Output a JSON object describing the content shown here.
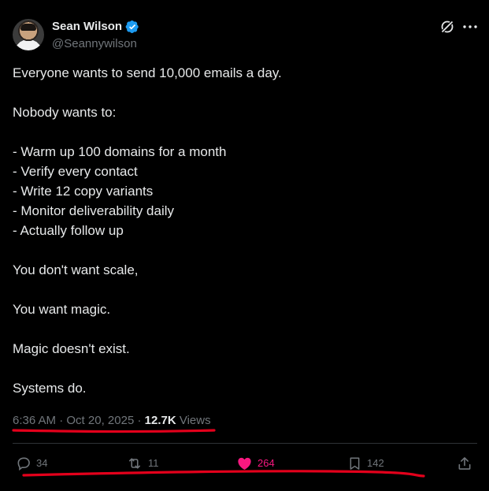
{
  "author": {
    "display_name": "Sean Wilson",
    "handle": "@Seannywilson",
    "verified": true
  },
  "header_icons": {
    "grok": "grok-icon",
    "more": "more-dots-icon"
  },
  "body_lines": [
    "Everyone wants to send 10,000 emails a day.",
    "",
    "Nobody wants to:",
    "",
    "- Warm up 100 domains for a month",
    "- Verify every contact",
    "- Write 12 copy variants",
    "- Monitor deliverability daily",
    "- Actually follow up",
    "",
    "You don't want scale,",
    "",
    "You want magic.",
    "",
    "Magic doesn't exist.",
    "",
    "Systems do."
  ],
  "meta": {
    "time": "6:36 AM",
    "separator": "·",
    "date": "Oct 20, 2025",
    "views_count": "12.7K",
    "views_label": "Views"
  },
  "actions": {
    "replies": {
      "icon": "reply-icon",
      "count": "34"
    },
    "reposts": {
      "icon": "repost-icon",
      "count": "11"
    },
    "likes": {
      "icon": "heart-icon",
      "count": "264",
      "active": true
    },
    "bookmarks": {
      "icon": "bookmark-icon",
      "count": "142"
    },
    "share": {
      "icon": "share-icon"
    }
  },
  "colors": {
    "background": "#000000",
    "text_primary": "#e7e9ea",
    "text_secondary": "#71767b",
    "verified_blue": "#1d9bf0",
    "like_pink": "#f91880",
    "annotation_red": "#e3001b",
    "divider": "#2f3336"
  }
}
